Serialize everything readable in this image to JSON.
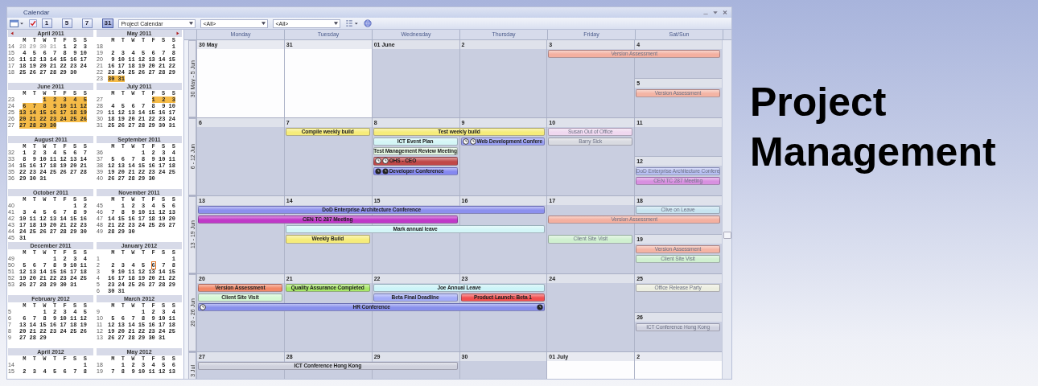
{
  "window": {
    "title": "Calendar"
  },
  "toolbar": {
    "view_buttons": [
      {
        "label": "1",
        "selected": false
      },
      {
        "label": "5",
        "selected": false
      },
      {
        "label": "7",
        "selected": false
      },
      {
        "label": "31",
        "selected": true
      }
    ],
    "calendar_select": "Project Calendar",
    "filter_1": "<All>",
    "filter_2": "<All>"
  },
  "mini_calendars": [
    {
      "title": "April 2011",
      "weekdays": [
        "M",
        "T",
        "W",
        "T",
        "F",
        "S",
        "S"
      ],
      "weeks": [
        {
          "no": "14",
          "selected": false,
          "kind": "full",
          "parts": [
            {
              "text": "28 29 30 31",
              "kind": "other_month"
            },
            {
              "text": "1  2  3",
              "kind": "day"
            }
          ]
        },
        {
          "no": "15",
          "selected": false,
          "kind": "full",
          "days": "4  5  6  7  8  9 10"
        },
        {
          "no": "16",
          "selected": false,
          "kind": "full",
          "days": "11 12 13 14 15 16 17"
        },
        {
          "no": "17",
          "selected": false,
          "kind": "full",
          "days": "18 19 20 21 22 23 24"
        },
        {
          "no": "18",
          "selected": false,
          "kind": "full",
          "days": "25 26 27 28 29 30"
        }
      ]
    },
    {
      "title": "May 2011",
      "weekdays": [
        "M",
        "T",
        "W",
        "T",
        "F",
        "S",
        "S"
      ],
      "weeks": [
        {
          "no": "18",
          "selected": false,
          "kind": "from_sun",
          "days": "1"
        },
        {
          "no": "19",
          "selected": false,
          "kind": "full",
          "days": "2  3  4  5  6  7  8"
        },
        {
          "no": "20",
          "selected": false,
          "kind": "full",
          "days": "9 10 11 12 13 14 15"
        },
        {
          "no": "21",
          "selected": false,
          "kind": "full",
          "days": "16 17 18 19 20 21 22"
        },
        {
          "no": "22",
          "selected": false,
          "kind": "full",
          "days": "23 24 25 26 27 28 29"
        },
        {
          "no": "23",
          "selected": true,
          "kind": "full",
          "days": "30 31"
        }
      ]
    },
    {
      "title": "June 2011",
      "weekdays": [
        "M",
        "T",
        "W",
        "T",
        "F",
        "S",
        "S"
      ],
      "weeks": [
        {
          "no": "23",
          "selected": true,
          "kind": "from_wed",
          "days": "1  2  3  4  5"
        },
        {
          "no": "24",
          "selected": true,
          "kind": "full",
          "days": "6  7  8  9 10 11 12"
        },
        {
          "no": "25",
          "selected": true,
          "kind": "full",
          "days": "13 14 15 16 17 18 19"
        },
        {
          "no": "26",
          "selected": true,
          "kind": "full",
          "days": "20 21 22 23 24 25 26"
        },
        {
          "no": "27",
          "selected": true,
          "kind": "full",
          "days": "27 28 29 30"
        }
      ]
    },
    {
      "title": "July 2011",
      "weekdays": [
        "M",
        "T",
        "W",
        "T",
        "F",
        "S",
        "S"
      ],
      "weeks": [
        {
          "no": "27",
          "selected": true,
          "kind": "from_fri",
          "days": "1  2  3"
        },
        {
          "no": "28",
          "selected": false,
          "kind": "full",
          "days": "4  5  6  7  8  9 10"
        },
        {
          "no": "29",
          "selected": false,
          "kind": "full",
          "days": "11 12 13 14 15 16 17"
        },
        {
          "no": "30",
          "selected": false,
          "kind": "full",
          "days": "18 19 20 21 22 23 24"
        },
        {
          "no": "31",
          "selected": false,
          "kind": "full",
          "days": "25 26 27 28 29 30 31"
        }
      ]
    },
    {
      "title": "August 2011",
      "weekdays": [
        "M",
        "T",
        "W",
        "T",
        "F",
        "S",
        "S"
      ],
      "weeks": [
        {
          "no": "32",
          "selected": false,
          "kind": "full",
          "days": "1  2  3  4  5  6  7"
        },
        {
          "no": "33",
          "selected": false,
          "kind": "full",
          "days": "8  9 10 11 12 13 14"
        },
        {
          "no": "34",
          "selected": false,
          "kind": "full",
          "days": "15 16 17 18 19 20 21"
        },
        {
          "no": "35",
          "selected": false,
          "kind": "full",
          "days": "22 23 24 25 26 27 28"
        },
        {
          "no": "36",
          "selected": false,
          "kind": "full",
          "days": "29 30 31"
        }
      ]
    },
    {
      "title": "September 2011",
      "weekdays": [
        "M",
        "T",
        "W",
        "T",
        "F",
        "S",
        "S"
      ],
      "weeks": [
        {
          "no": "36",
          "selected": false,
          "kind": "from_thu",
          "days": "1  2  3  4"
        },
        {
          "no": "37",
          "selected": false,
          "kind": "full",
          "days": "5  6  7  8  9 10 11"
        },
        {
          "no": "38",
          "selected": false,
          "kind": "full",
          "days": "12 13 14 15 16 17 18"
        },
        {
          "no": "39",
          "selected": false,
          "kind": "full",
          "days": "19 20 21 22 23 24 25"
        },
        {
          "no": "40",
          "selected": false,
          "kind": "full",
          "days": "26 27 28 29 30"
        }
      ]
    },
    {
      "title": "October 2011",
      "weekdays": [
        "M",
        "T",
        "W",
        "T",
        "F",
        "S",
        "S"
      ],
      "weeks": [
        {
          "no": "40",
          "selected": false,
          "kind": "from_sat",
          "days": "1  2"
        },
        {
          "no": "41",
          "selected": false,
          "kind": "full",
          "days": "3  4  5  6  7  8  9"
        },
        {
          "no": "42",
          "selected": false,
          "kind": "full",
          "days": "10 11 12 13 14 15 16"
        },
        {
          "no": "43",
          "selected": false,
          "kind": "full",
          "days": "17 18 19 20 21 22 23"
        },
        {
          "no": "44",
          "selected": false,
          "kind": "full",
          "days": "24 25 26 27 28 29 30"
        },
        {
          "no": "45",
          "selected": false,
          "kind": "full",
          "days": "31"
        }
      ]
    },
    {
      "title": "November 2011",
      "weekdays": [
        "M",
        "T",
        "W",
        "T",
        "F",
        "S",
        "S"
      ],
      "weeks": [
        {
          "no": "45",
          "selected": false,
          "kind": "from_tue",
          "days": "1  2  3  4  5  6"
        },
        {
          "no": "46",
          "selected": false,
          "kind": "full",
          "days": "7  8  9 10 11 12 13"
        },
        {
          "no": "47",
          "selected": false,
          "kind": "full",
          "days": "14 15 16 17 18 19 20"
        },
        {
          "no": "48",
          "selected": false,
          "kind": "full",
          "days": "21 22 23 24 25 26 27"
        },
        {
          "no": "49",
          "selected": false,
          "kind": "full",
          "days": "28 29 30"
        }
      ]
    },
    {
      "title": "December 2011",
      "weekdays": [
        "M",
        "T",
        "W",
        "T",
        "F",
        "S",
        "S"
      ],
      "weeks": [
        {
          "no": "49",
          "selected": false,
          "kind": "from_thu",
          "days": "1  2  3  4"
        },
        {
          "no": "50",
          "selected": false,
          "kind": "full",
          "days": "5  6  7  8  9 10 11"
        },
        {
          "no": "51",
          "selected": false,
          "kind": "full",
          "days": "12 13 14 15 16 17 18"
        },
        {
          "no": "52",
          "selected": false,
          "kind": "full",
          "days": "19 20 21 22 23 24 25"
        },
        {
          "no": "53",
          "selected": false,
          "kind": "full",
          "days": "26 27 28 29 30 31"
        }
      ]
    },
    {
      "title": "January 2012",
      "weekdays": [
        "M",
        "T",
        "W",
        "T",
        "F",
        "S",
        "S"
      ],
      "weeks": [
        {
          "no": "1",
          "selected": false,
          "kind": "from_sun",
          "days": "1"
        },
        {
          "no": "2",
          "selected": false,
          "kind": "full",
          "parts": [
            {
              "text": "2  3  4  5",
              "kind": "day"
            },
            {
              "text": "6",
              "kind": "today"
            },
            {
              "text": "7  8",
              "kind": "day"
            }
          ]
        },
        {
          "no": "3",
          "selected": false,
          "kind": "full",
          "days": "9 10 11 12 13 14 15"
        },
        {
          "no": "4",
          "selected": false,
          "kind": "full",
          "days": "16 17 18 19 20 21 22"
        },
        {
          "no": "5",
          "selected": false,
          "kind": "full",
          "days": "23 24 25 26 27 28 29"
        },
        {
          "no": "6",
          "selected": false,
          "kind": "full",
          "days": "30 31"
        }
      ]
    },
    {
      "title": "February 2012",
      "weekdays": [
        "M",
        "T",
        "W",
        "T",
        "F",
        "S",
        "S"
      ],
      "weeks": [
        {
          "no": "5",
          "selected": false,
          "kind": "from_wed",
          "days": "1  2  3  4  5"
        },
        {
          "no": "6",
          "selected": false,
          "kind": "full",
          "days": "6  7  8  9 10 11 12"
        },
        {
          "no": "7",
          "selected": false,
          "kind": "full",
          "days": "13 14 15 16 17 18 19"
        },
        {
          "no": "8",
          "selected": false,
          "kind": "full",
          "days": "20 21 22 23 24 25 26"
        },
        {
          "no": "9",
          "selected": false,
          "kind": "full",
          "days": "27 28 29"
        }
      ]
    },
    {
      "title": "March 2012",
      "weekdays": [
        "M",
        "T",
        "W",
        "T",
        "F",
        "S",
        "S"
      ],
      "weeks": [
        {
          "no": "9",
          "selected": false,
          "kind": "from_thu",
          "days": "1  2  3  4"
        },
        {
          "no": "10",
          "selected": false,
          "kind": "full",
          "days": "5  6  7  8  9 10 11"
        },
        {
          "no": "11",
          "selected": false,
          "kind": "full",
          "days": "12 13 14 15 16 17 18"
        },
        {
          "no": "12",
          "selected": false,
          "kind": "full",
          "days": "19 20 21 22 23 24 25"
        },
        {
          "no": "13",
          "selected": false,
          "kind": "full",
          "days": "26 27 28 29 30 31"
        }
      ]
    },
    {
      "title": "April 2012",
      "weekdays": [
        "M",
        "T",
        "W",
        "T",
        "F",
        "S",
        "S"
      ],
      "weeks": [
        {
          "no": "14",
          "selected": false,
          "kind": "from_sun",
          "days": "1"
        },
        {
          "no": "15",
          "selected": false,
          "kind": "full",
          "days": "2  3  4  5  6  7  8"
        }
      ]
    },
    {
      "title": "May 2012",
      "weekdays": [
        "M",
        "T",
        "W",
        "T",
        "F",
        "S",
        "S"
      ],
      "weeks": [
        {
          "no": "18",
          "selected": false,
          "kind": "from_tue",
          "days": "1  2  3  4  5  6"
        },
        {
          "no": "19",
          "selected": false,
          "kind": "full",
          "days": "7  8  9 10 11 12 13"
        }
      ]
    }
  ],
  "grid": {
    "day_headers": [
      "Monday",
      "Tuesday",
      "Wednesday",
      "Thursday",
      "Friday",
      "Sat/Sun"
    ],
    "weeks": [
      {
        "label": "30 May - 5 Jun",
        "days": [
          {
            "kind": "mon",
            "date": "30 May",
            "other_month": true
          },
          {
            "kind": "tue",
            "date": "31",
            "other_month": true
          },
          {
            "kind": "wed",
            "date": "01 June",
            "other_month": false
          },
          {
            "kind": "thu",
            "date": "2",
            "other_month": false
          },
          {
            "kind": "fri",
            "date": "3",
            "other_month": false
          },
          {
            "kind": "sat",
            "date": "4",
            "other_month": false
          },
          {
            "kind": "sun",
            "date": "5",
            "other_month": false
          }
        ],
        "lanes": [
          {
            "kind": "l1",
            "events": [
              {
                "title": "Version Assessment",
                "kind": "fri-sat",
                "color": "#f4b0a0",
                "faded": true
              }
            ]
          },
          {
            "kind": "l5",
            "events": [
              {
                "title": "Version Assessment",
                "kind": "sun",
                "color": "#f4b4a4",
                "faded": true
              }
            ]
          }
        ]
      },
      {
        "label": "6 - 12 Jun",
        "days": [
          {
            "kind": "mon",
            "date": "6",
            "other_month": false
          },
          {
            "kind": "tue",
            "date": "7",
            "other_month": false
          },
          {
            "kind": "wed",
            "date": "8",
            "other_month": false
          },
          {
            "kind": "thu",
            "date": "9",
            "other_month": false
          },
          {
            "kind": "fri",
            "date": "10",
            "other_month": false
          },
          {
            "kind": "sat",
            "date": "11",
            "other_month": false
          },
          {
            "kind": "sun",
            "date": "12",
            "other_month": false
          }
        ],
        "lanes": [
          {
            "kind": "l1",
            "events": [
              {
                "title": "Compile weekly build",
                "kind": "tue",
                "color": "#f6ec7a",
                "faded": false
              },
              {
                "title": "Test weekly build",
                "kind": "wed-thu",
                "color": "#f6ec7a",
                "faded": false
              },
              {
                "title": "Susan Out of Office",
                "kind": "fri",
                "color": "#f0d8f0",
                "faded": true
              }
            ]
          },
          {
            "kind": "l2",
            "events": [
              {
                "title": "ICT Event Plan",
                "kind": "wed",
                "color": "#d4f6f6",
                "faded": false
              },
              {
                "title": "Web Development Confere",
                "kind": "thu",
                "color": "#9aa0f4",
                "faded": false,
                "icons": [
                  {
                    "kind": "clock_start"
                  },
                  {
                    "kind": "clock_start"
                  }
                ]
              },
              {
                "title": "Barry Sick",
                "kind": "fri",
                "color": "#d8dae0",
                "faded": true
              }
            ]
          },
          {
            "kind": "l3",
            "events": [
              {
                "title": "Test Management Review Meeting",
                "kind": "wed",
                "color": "#e2f6e0",
                "faded": false
              }
            ]
          },
          {
            "kind": "l4",
            "events": [
              {
                "title": "OHS - CEO",
                "kind": "wed",
                "color": "#c04848",
                "faded": false,
                "icons": [
                  {
                    "kind": "clock_start"
                  },
                  {
                    "kind": "clock_start"
                  }
                ]
              }
            ]
          },
          {
            "kind": "l5",
            "events": [
              {
                "title": "Developer Conference",
                "kind": "wed",
                "color": "#8488f0",
                "faded": false,
                "icons": [
                  {
                    "kind": "disc_start"
                  },
                  {
                    "kind": "disc_start"
                  }
                ]
              },
              {
                "title": "DoD Enterprise Architecture Confere",
                "kind": "sun",
                "color": "#b8c0f4",
                "faded": true
              }
            ]
          },
          {
            "kind": "l6",
            "events": [
              {
                "title": "CEN TC 287 Meeting",
                "kind": "sun",
                "color": "#d890e0",
                "faded": true
              }
            ]
          }
        ]
      },
      {
        "label": "13 - 19 Jun",
        "days": [
          {
            "kind": "mon",
            "date": "13",
            "other_month": false
          },
          {
            "kind": "tue",
            "date": "14",
            "other_month": false
          },
          {
            "kind": "wed",
            "date": "15",
            "other_month": false
          },
          {
            "kind": "thu",
            "date": "16",
            "other_month": false
          },
          {
            "kind": "fri",
            "date": "17",
            "other_month": false
          },
          {
            "kind": "sat",
            "date": "18",
            "other_month": false
          },
          {
            "kind": "sun",
            "date": "19",
            "other_month": false
          }
        ],
        "lanes": [
          {
            "kind": "l1",
            "events": [
              {
                "title": "DoD Enterprise Architecture Conference",
                "kind": "mon-thu",
                "color": "#8c90ee",
                "faded": false
              },
              {
                "title": "Clive on Leave",
                "kind": "sat",
                "color": "#c8e4f0",
                "faded": true
              }
            ]
          },
          {
            "kind": "l2",
            "events": [
              {
                "title": "CEN TC 287 Meeting",
                "kind": "mon-wed",
                "color": "#c038c8",
                "faded": false
              },
              {
                "title": "Version Assessment",
                "kind": "fri-sat",
                "color": "#f4b0a0",
                "faded": true
              }
            ]
          },
          {
            "kind": "l3",
            "events": [
              {
                "title": "Mark annual leave",
                "kind": "tue-thu",
                "color": "#d4f6f8",
                "faded": false
              }
            ]
          },
          {
            "kind": "l4",
            "events": [
              {
                "title": "Weekly Build",
                "kind": "tue",
                "color": "#f6ec7a",
                "faded": false
              },
              {
                "title": "Client Site Visit",
                "kind": "fri",
                "color": "#d0f0d0",
                "faded": true
              }
            ]
          },
          {
            "kind": "l5",
            "events": [
              {
                "title": "Version Assessment",
                "kind": "sun",
                "color": "#f4b4a4",
                "faded": true
              }
            ]
          },
          {
            "kind": "l6",
            "events": [
              {
                "title": "Client Site Visit",
                "kind": "sun",
                "color": "#d0f0d0",
                "faded": true
              }
            ]
          }
        ]
      },
      {
        "label": "20 - 26 Jun",
        "days": [
          {
            "kind": "mon",
            "date": "20",
            "other_month": false
          },
          {
            "kind": "tue",
            "date": "21",
            "other_month": false
          },
          {
            "kind": "wed",
            "date": "22",
            "other_month": false
          },
          {
            "kind": "thu",
            "date": "23",
            "other_month": false
          },
          {
            "kind": "fri",
            "date": "24",
            "other_month": false
          },
          {
            "kind": "sat",
            "date": "25",
            "other_month": false
          },
          {
            "kind": "sun",
            "date": "26",
            "other_month": false
          }
        ],
        "lanes": [
          {
            "kind": "l1",
            "events": [
              {
                "title": "Version Assessment",
                "kind": "mon",
                "color": "#f28868",
                "faded": false
              },
              {
                "title": "Quality Assurance Completed",
                "kind": "tue",
                "color": "#a8e868",
                "faded": false
              },
              {
                "title": "Joe Annual Leave",
                "kind": "wed-thu",
                "color": "#ccf4f8",
                "faded": false
              },
              {
                "title": "Office Release Party",
                "kind": "sat",
                "color": "#eceee0",
                "faded": true
              }
            ]
          },
          {
            "kind": "l2",
            "events": [
              {
                "title": "Client Site Visit",
                "kind": "mon",
                "color": "#d4f8d4",
                "faded": false
              },
              {
                "title": "Beta Final Deadline",
                "kind": "wed",
                "color": "#a4acf8",
                "faded": false
              },
              {
                "title": "Product Launch: Beta 1",
                "kind": "thu",
                "color": "#f25050",
                "faded": false
              }
            ]
          },
          {
            "kind": "l3",
            "events": [
              {
                "title": "HR Conference",
                "kind": "mon-thu",
                "color": "#8890ec",
                "faded": false,
                "icons": [
                  {
                    "kind": "clock_start"
                  },
                  {
                    "kind": "disc_end"
                  }
                ]
              }
            ]
          },
          {
            "kind": "l5",
            "events": [
              {
                "title": "ICT Conference Hong Kong",
                "kind": "sun",
                "color": "#d0d2e0",
                "faded": true
              }
            ]
          }
        ]
      },
      {
        "label": "3 Jul",
        "days": [
          {
            "kind": "mon",
            "date": "27",
            "other_month": false
          },
          {
            "kind": "tue",
            "date": "28",
            "other_month": false
          },
          {
            "kind": "wed",
            "date": "29",
            "other_month": false
          },
          {
            "kind": "thu",
            "date": "30",
            "other_month": false
          },
          {
            "kind": "fri",
            "date": "01 July",
            "other_month": true
          },
          {
            "kind": "sat",
            "date": "2",
            "other_month": true
          }
        ],
        "lanes": [
          {
            "kind": "l1",
            "events": [
              {
                "title": "ICT Conference Hong Kong",
                "kind": "mon-wed",
                "color": "#cfd1dd",
                "faded": false
              }
            ]
          }
        ]
      }
    ]
  },
  "heading": "Project Management"
}
